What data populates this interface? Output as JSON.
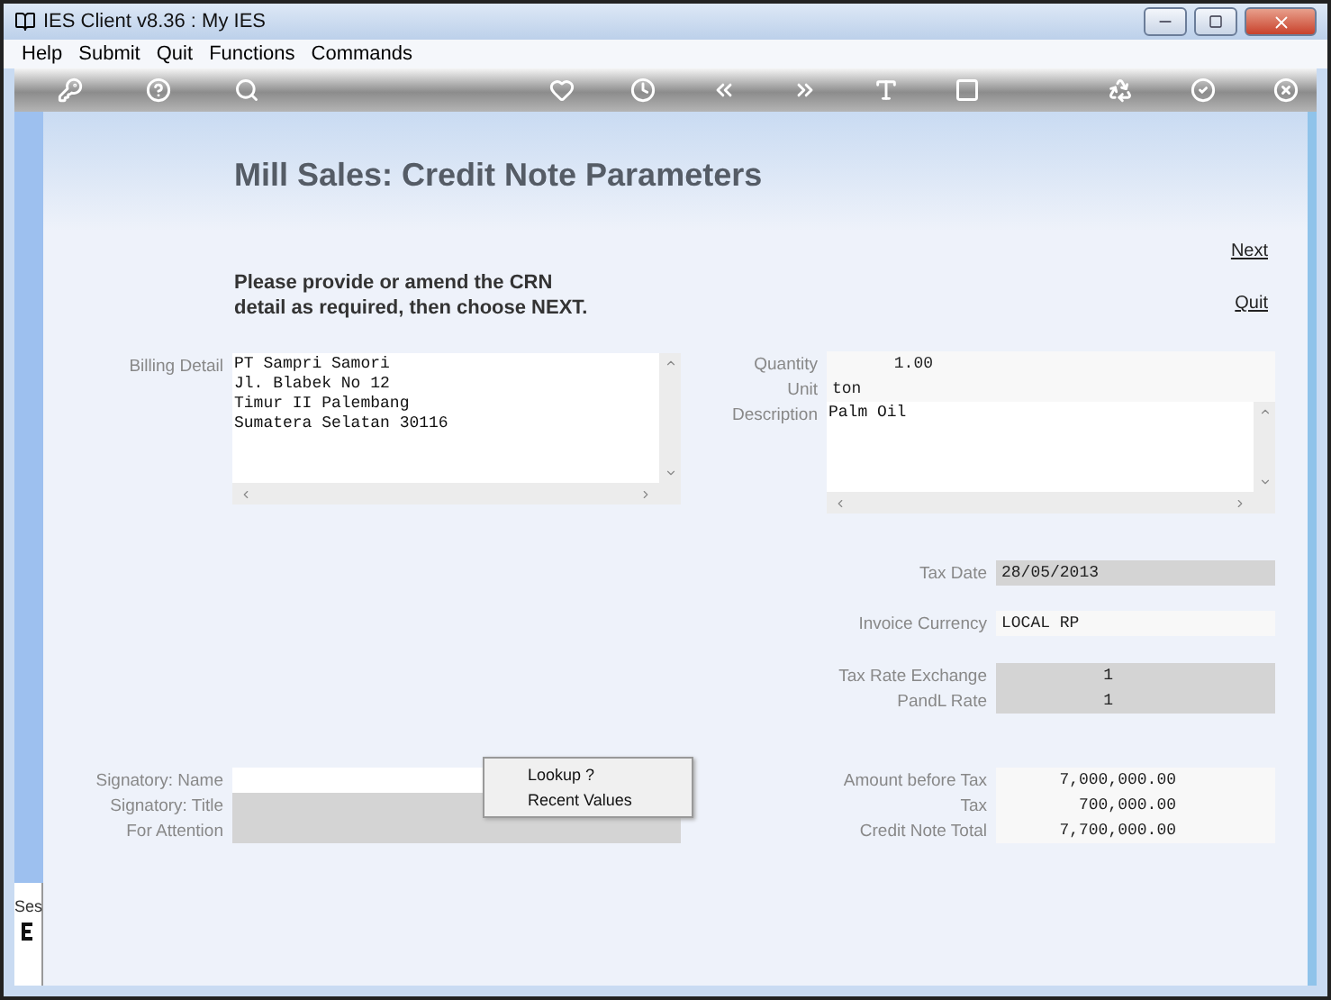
{
  "window": {
    "title": "IES Client v8.36 : My IES"
  },
  "menu": [
    "Help",
    "Submit",
    "Quit",
    "Functions",
    "Commands"
  ],
  "heading": "Mill Sales: Credit Note  Parameters",
  "instruction": [
    "Please provide or amend the CRN",
    "detail as required, then choose NEXT."
  ],
  "links": [
    "Next",
    "Quit"
  ],
  "billing": {
    "label": "Billing Detail",
    "value": "PT Sampri Samori\nJl. Blabek No 12\nTimur II Palembang\nSumatera Selatan 30116"
  },
  "product": [
    {
      "label": "Quantity",
      "value": "1.00",
      "readonly": false
    },
    {
      "label": "Unit",
      "value": "ton",
      "readonly": false
    }
  ],
  "description": {
    "label": "Description",
    "value": "Palm Oil"
  },
  "tax_date": {
    "label": "Tax Date",
    "value": "28/05/2013",
    "readonly": true
  },
  "currency": {
    "label": "Invoice Currency",
    "value": "LOCAL RP",
    "readonly": false
  },
  "rates": [
    {
      "label": "Tax Rate Exchange",
      "value": "1",
      "readonly": true
    },
    {
      "label": "PandL Rate",
      "value": "1",
      "readonly": true
    }
  ],
  "signatory": [
    {
      "label": "Signatory: Name",
      "readonly": false
    },
    {
      "label": "Signatory: Title",
      "readonly": true
    },
    {
      "label": "For Attention",
      "readonly": true
    }
  ],
  "amounts": [
    {
      "label": "Amount before Tax",
      "value": "7,000,000.00",
      "readonly": false
    },
    {
      "label": "Tax",
      "value": "700,000.00",
      "readonly": false
    },
    {
      "label": "Credit Note Total",
      "value": "7,700,000.00",
      "readonly": false
    }
  ],
  "context_menu": [
    "Lookup ?",
    "Recent Values"
  ],
  "session_tab": "Ses"
}
